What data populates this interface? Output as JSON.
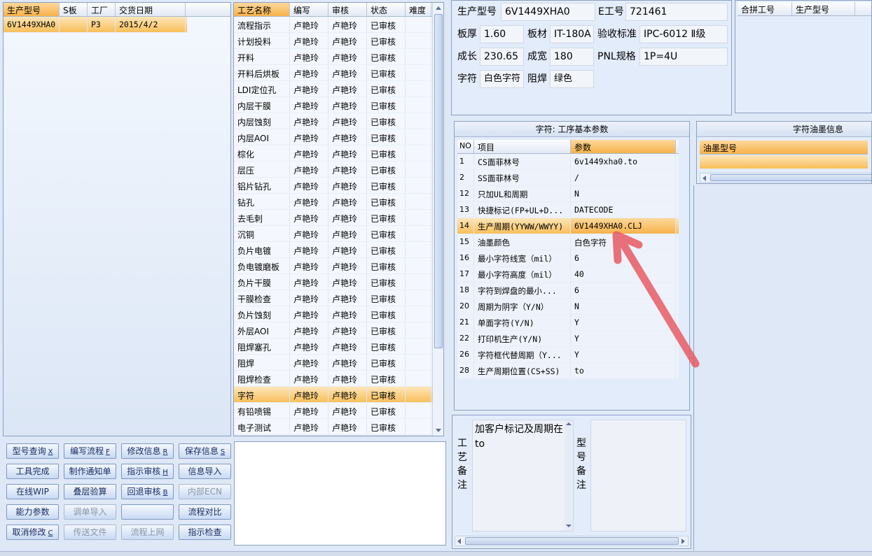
{
  "product_grid": {
    "headers": [
      "生产型号",
      "S板",
      "工厂",
      "交货日期"
    ],
    "rows": [
      [
        "6V1449XHA0",
        "",
        "P3",
        "2015/4/2"
      ]
    ]
  },
  "process_grid": {
    "headers": [
      "工艺名称",
      "编写",
      "审核",
      "状态",
      "难度"
    ],
    "rows": [
      [
        "流程指示",
        "卢艳玲",
        "卢艳玲",
        "已审核",
        ""
      ],
      [
        "计划投料",
        "卢艳玲",
        "卢艳玲",
        "已审核",
        ""
      ],
      [
        "开料",
        "卢艳玲",
        "卢艳玲",
        "已审核",
        ""
      ],
      [
        "开料后烘板",
        "卢艳玲",
        "卢艳玲",
        "已审核",
        ""
      ],
      [
        "LDI定位孔",
        "卢艳玲",
        "卢艳玲",
        "已审核",
        ""
      ],
      [
        "内层干膜",
        "卢艳玲",
        "卢艳玲",
        "已审核",
        ""
      ],
      [
        "内层蚀刻",
        "卢艳玲",
        "卢艳玲",
        "已审核",
        ""
      ],
      [
        "内层AOI",
        "卢艳玲",
        "卢艳玲",
        "已审核",
        ""
      ],
      [
        "棕化",
        "卢艳玲",
        "卢艳玲",
        "已审核",
        ""
      ],
      [
        "层压",
        "卢艳玲",
        "卢艳玲",
        "已审核",
        ""
      ],
      [
        "铝片钻孔",
        "卢艳玲",
        "卢艳玲",
        "已审核",
        ""
      ],
      [
        "钻孔",
        "卢艳玲",
        "卢艳玲",
        "已审核",
        ""
      ],
      [
        "去毛刺",
        "卢艳玲",
        "卢艳玲",
        "已审核",
        ""
      ],
      [
        "沉铜",
        "卢艳玲",
        "卢艳玲",
        "已审核",
        ""
      ],
      [
        "负片电镀",
        "卢艳玲",
        "卢艳玲",
        "已审核",
        ""
      ],
      [
        "负电镀磨板",
        "卢艳玲",
        "卢艳玲",
        "已审核",
        ""
      ],
      [
        "负片干膜",
        "卢艳玲",
        "卢艳玲",
        "已审核",
        ""
      ],
      [
        "干膜检查",
        "卢艳玲",
        "卢艳玲",
        "已审核",
        ""
      ],
      [
        "负片蚀刻",
        "卢艳玲",
        "卢艳玲",
        "已审核",
        ""
      ],
      [
        "外层AOI",
        "卢艳玲",
        "卢艳玲",
        "已审核",
        ""
      ],
      [
        "阻焊塞孔",
        "卢艳玲",
        "卢艳玲",
        "已审核",
        ""
      ],
      [
        "阻焊",
        "卢艳玲",
        "卢艳玲",
        "已审核",
        ""
      ],
      [
        "阻焊检查",
        "卢艳玲",
        "卢艳玲",
        "已审核",
        ""
      ],
      [
        "字符",
        "卢艳玲",
        "卢艳玲",
        "已审核",
        ""
      ],
      [
        "有铅喷锡",
        "卢艳玲",
        "卢艳玲",
        "已审核",
        ""
      ],
      [
        "电子测试",
        "卢艳玲",
        "卢艳玲",
        "已审核",
        ""
      ]
    ],
    "selected_index": 23
  },
  "buttons": [
    [
      {
        "label": "型号查询",
        "key": "X",
        "enabled": true
      },
      {
        "label": "编写流程",
        "key": "F",
        "enabled": true
      },
      {
        "label": "修改信息",
        "key": "R",
        "enabled": true
      },
      {
        "label": "保存信息",
        "key": "S",
        "enabled": true
      }
    ],
    [
      {
        "label": "工具完成",
        "key": "",
        "enabled": true
      },
      {
        "label": "制作通知单",
        "key": "",
        "enabled": true
      },
      {
        "label": "指示审核",
        "key": "H",
        "enabled": true
      },
      {
        "label": "信息导入",
        "key": "",
        "enabled": true
      }
    ],
    [
      {
        "label": "在线WIP",
        "key": "",
        "enabled": true
      },
      {
        "label": "叠层验算",
        "key": "",
        "enabled": true
      },
      {
        "label": "回退审核",
        "key": "B",
        "enabled": true
      },
      {
        "label": "内部ECN",
        "key": "",
        "enabled": false
      }
    ],
    [
      {
        "label": "能力参数",
        "key": "",
        "enabled": true
      },
      {
        "label": "调单导入",
        "key": "",
        "enabled": false
      },
      {
        "label": "",
        "key": "",
        "enabled": true
      },
      {
        "label": "流程对比",
        "key": "",
        "enabled": true
      }
    ],
    [
      {
        "label": "取消修改",
        "key": "C",
        "enabled": true
      },
      {
        "label": "传送文件",
        "key": "",
        "enabled": false
      },
      {
        "label": "流程上网",
        "key": "",
        "enabled": false
      },
      {
        "label": "指示检查",
        "key": "",
        "enabled": true
      }
    ]
  ],
  "info": {
    "model_label": "生产型号",
    "model": "6V1449XHA0",
    "e_label": "E工号",
    "e_no": "721461",
    "thick_label": "板厚",
    "thick": "1.60",
    "material_label": "板材",
    "material": "IT-180A",
    "std_label": "验收标准",
    "std": "IPC-6012 Ⅱ级",
    "len_label": "成长",
    "len": "230.65",
    "wid_label": "成宽",
    "wid": "180",
    "pnl_label": "PNL规格",
    "pnl": "1P=4U",
    "char_label": "字符",
    "char": "白色字符",
    "mask_label": "阻焊",
    "mask": "绿色"
  },
  "merge_grid": {
    "headers": [
      "合拼工号",
      "生产型号"
    ]
  },
  "param_panel": {
    "title": "字符: 工序基本参数",
    "headers": [
      "NO",
      "项目",
      "参数"
    ],
    "rows": [
      [
        "1",
        "CS面菲林号",
        "6v1449xha0.to"
      ],
      [
        "2",
        "SS面菲林号",
        "/"
      ],
      [
        "12",
        "只加UL和周期",
        "N"
      ],
      [
        "13",
        "快捷标记(FP+UL+D...",
        "DATECODE"
      ],
      [
        "14",
        "生产周期(YYWW/WWYY)",
        "6V1449XHA0.CLJ"
      ],
      [
        "15",
        "油墨颜色",
        "白色字符"
      ],
      [
        "16",
        "最小字符线宽（mil）",
        "6"
      ],
      [
        "17",
        "最小字符高度（mil）",
        "40"
      ],
      [
        "18",
        "字符到焊盘的最小...",
        "6"
      ],
      [
        "20",
        "周期为阴字（Y/N）",
        "N"
      ],
      [
        "21",
        "单面字符(Y/N)",
        "Y"
      ],
      [
        "22",
        "打印机生产(Y/N)",
        "Y"
      ],
      [
        "26",
        "字符框代替周期（Y...",
        "Y"
      ],
      [
        "28",
        "生产周期位置(CS+SS)",
        "to"
      ]
    ],
    "selected_index": 4
  },
  "ink_panel": {
    "title": "字符油墨信息",
    "header": "油墨型号"
  },
  "notes": {
    "proc_label": [
      "工",
      "艺",
      "备",
      "注"
    ],
    "proc_text": "加客户标记及周期在to",
    "model_label": [
      "型",
      "号",
      "备",
      "注"
    ]
  },
  "arrow_color": "#e85a64"
}
